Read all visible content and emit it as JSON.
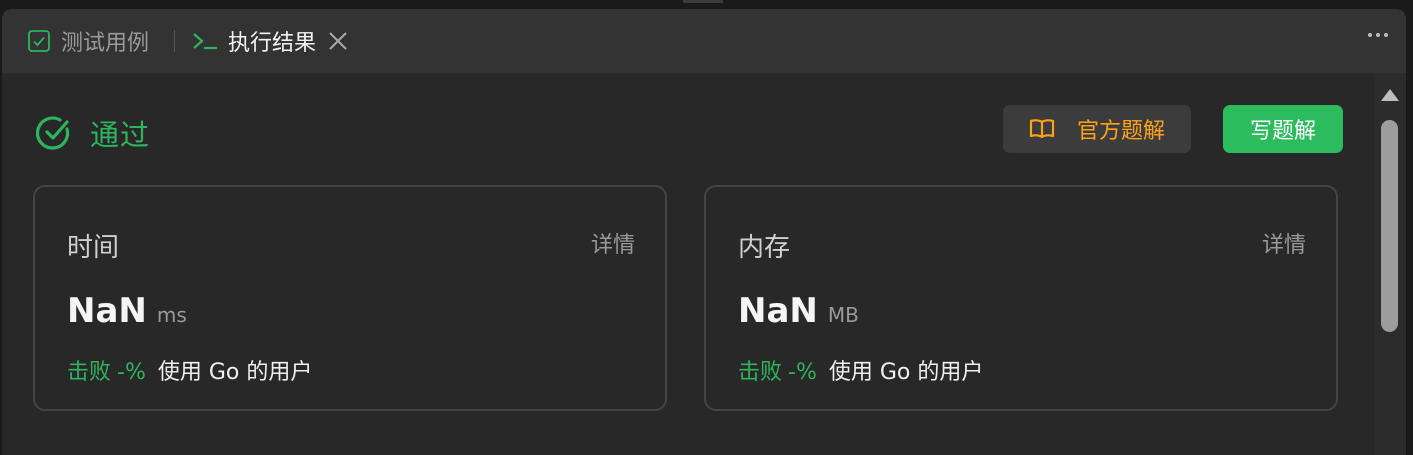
{
  "tabs": [
    {
      "label": "测试用例",
      "icon": "checkbox-icon",
      "active": false
    },
    {
      "label": "执行结果",
      "icon": "terminal-icon",
      "active": true,
      "closable": true
    }
  ],
  "status": {
    "text": "通过",
    "icon": "check-circle-icon",
    "color": "#2db55d"
  },
  "buttons": {
    "official_solution": "官方题解",
    "write_solution": "写题解"
  },
  "cards": {
    "time": {
      "title": "时间",
      "detail": "详情",
      "value": "NaN",
      "unit": "ms",
      "beat_label": "击败",
      "beat_pct": "-%",
      "beat_rest": "使用 Go 的用户"
    },
    "memory": {
      "title": "内存",
      "detail": "详情",
      "value": "NaN",
      "unit": "MB",
      "beat_label": "击败",
      "beat_pct": "-%",
      "beat_rest": "使用 Go 的用户"
    }
  },
  "colors": {
    "accent_green": "#2cbb5d",
    "accent_orange": "#ffa116",
    "background": "#282828"
  }
}
